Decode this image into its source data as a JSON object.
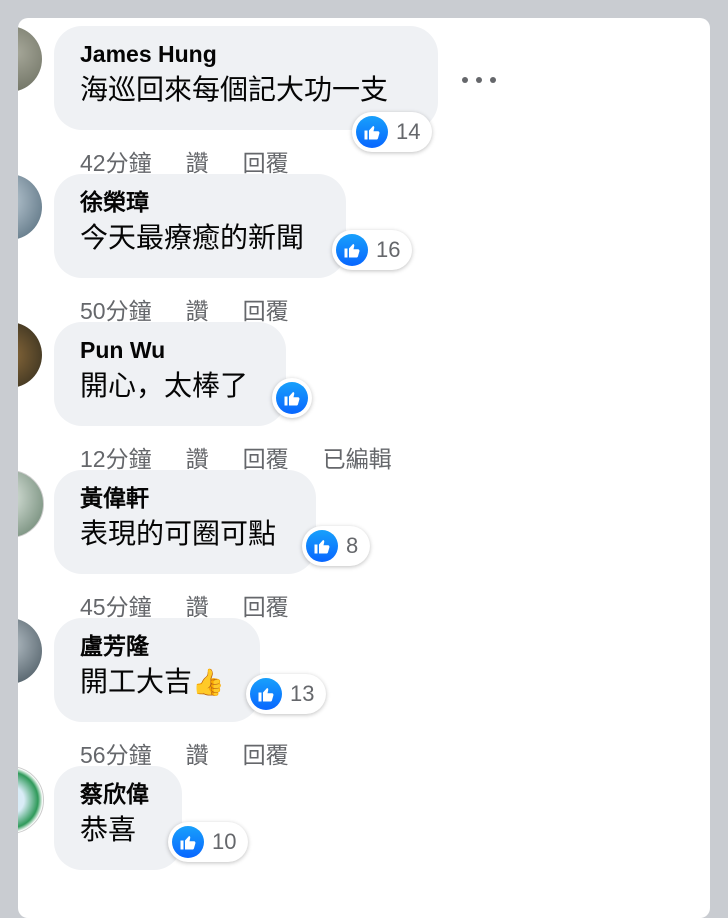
{
  "comments": [
    {
      "author": "James Hung",
      "text": "海巡回來每個記大功一支",
      "reactions": "14",
      "time": "42分鐘",
      "like": "讚",
      "reply": "回覆",
      "edited": ""
    },
    {
      "author": "徐榮璋",
      "text": "今天最療癒的新聞",
      "reactions": "16",
      "time": "50分鐘",
      "like": "讚",
      "reply": "回覆",
      "edited": ""
    },
    {
      "author": "Pun Wu",
      "text": "開心，太棒了",
      "reactions": "",
      "time": "12分鐘",
      "like": "讚",
      "reply": "回覆",
      "edited": "已編輯"
    },
    {
      "author": "黃偉軒",
      "text": "表現的可圈可點",
      "reactions": "8",
      "time": "45分鐘",
      "like": "讚",
      "reply": "回覆",
      "edited": ""
    },
    {
      "author": "盧芳隆",
      "text": "開工大吉",
      "emoji": "👍",
      "reactions": "13",
      "time": "56分鐘",
      "like": "讚",
      "reply": "回覆",
      "edited": ""
    },
    {
      "author": "蔡欣偉",
      "text": "恭喜",
      "reactions": "10",
      "time": "",
      "like": "",
      "reply": "",
      "edited": ""
    }
  ],
  "icons": {
    "like": "thumbs-up-icon",
    "more": "more-options-icon"
  },
  "colors": {
    "like_blue": "#0866ff",
    "bubble": "#eff1f4",
    "meta": "#65676b"
  }
}
